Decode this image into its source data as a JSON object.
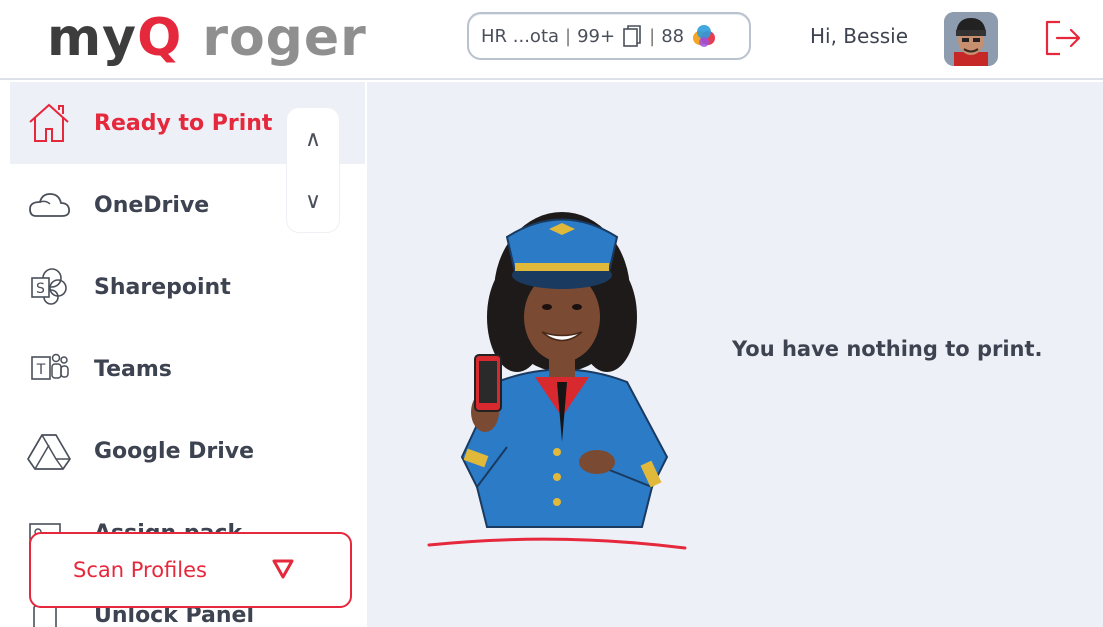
{
  "header": {
    "logo_part1": "myq",
    "logo_part2": "roger",
    "status": {
      "location": "HR ...ota",
      "sep1": "|",
      "jobs_count": "99+",
      "sep2": "|",
      "credit": "88"
    },
    "greeting": "Hi, Bessie",
    "accent_color": "#e5283c"
  },
  "sidebar": {
    "items": [
      {
        "label": "Ready to Print",
        "icon": "home-icon",
        "active": true
      },
      {
        "label": "OneDrive",
        "icon": "cloud-icon",
        "active": false
      },
      {
        "label": "Sharepoint",
        "icon": "sharepoint-icon",
        "active": false
      },
      {
        "label": "Teams",
        "icon": "teams-icon",
        "active": false
      },
      {
        "label": "Google Drive",
        "icon": "google-drive-icon",
        "active": false
      },
      {
        "label": "Assign pack",
        "icon": "id-card-icon",
        "active": false
      },
      {
        "label": "Unlock Panel",
        "icon": "tablet-icon",
        "active": false
      }
    ],
    "scroll_up": "∧",
    "scroll_down": "∨",
    "scan_profiles_label": "Scan Profiles"
  },
  "main": {
    "empty_message": "You have nothing to print."
  }
}
